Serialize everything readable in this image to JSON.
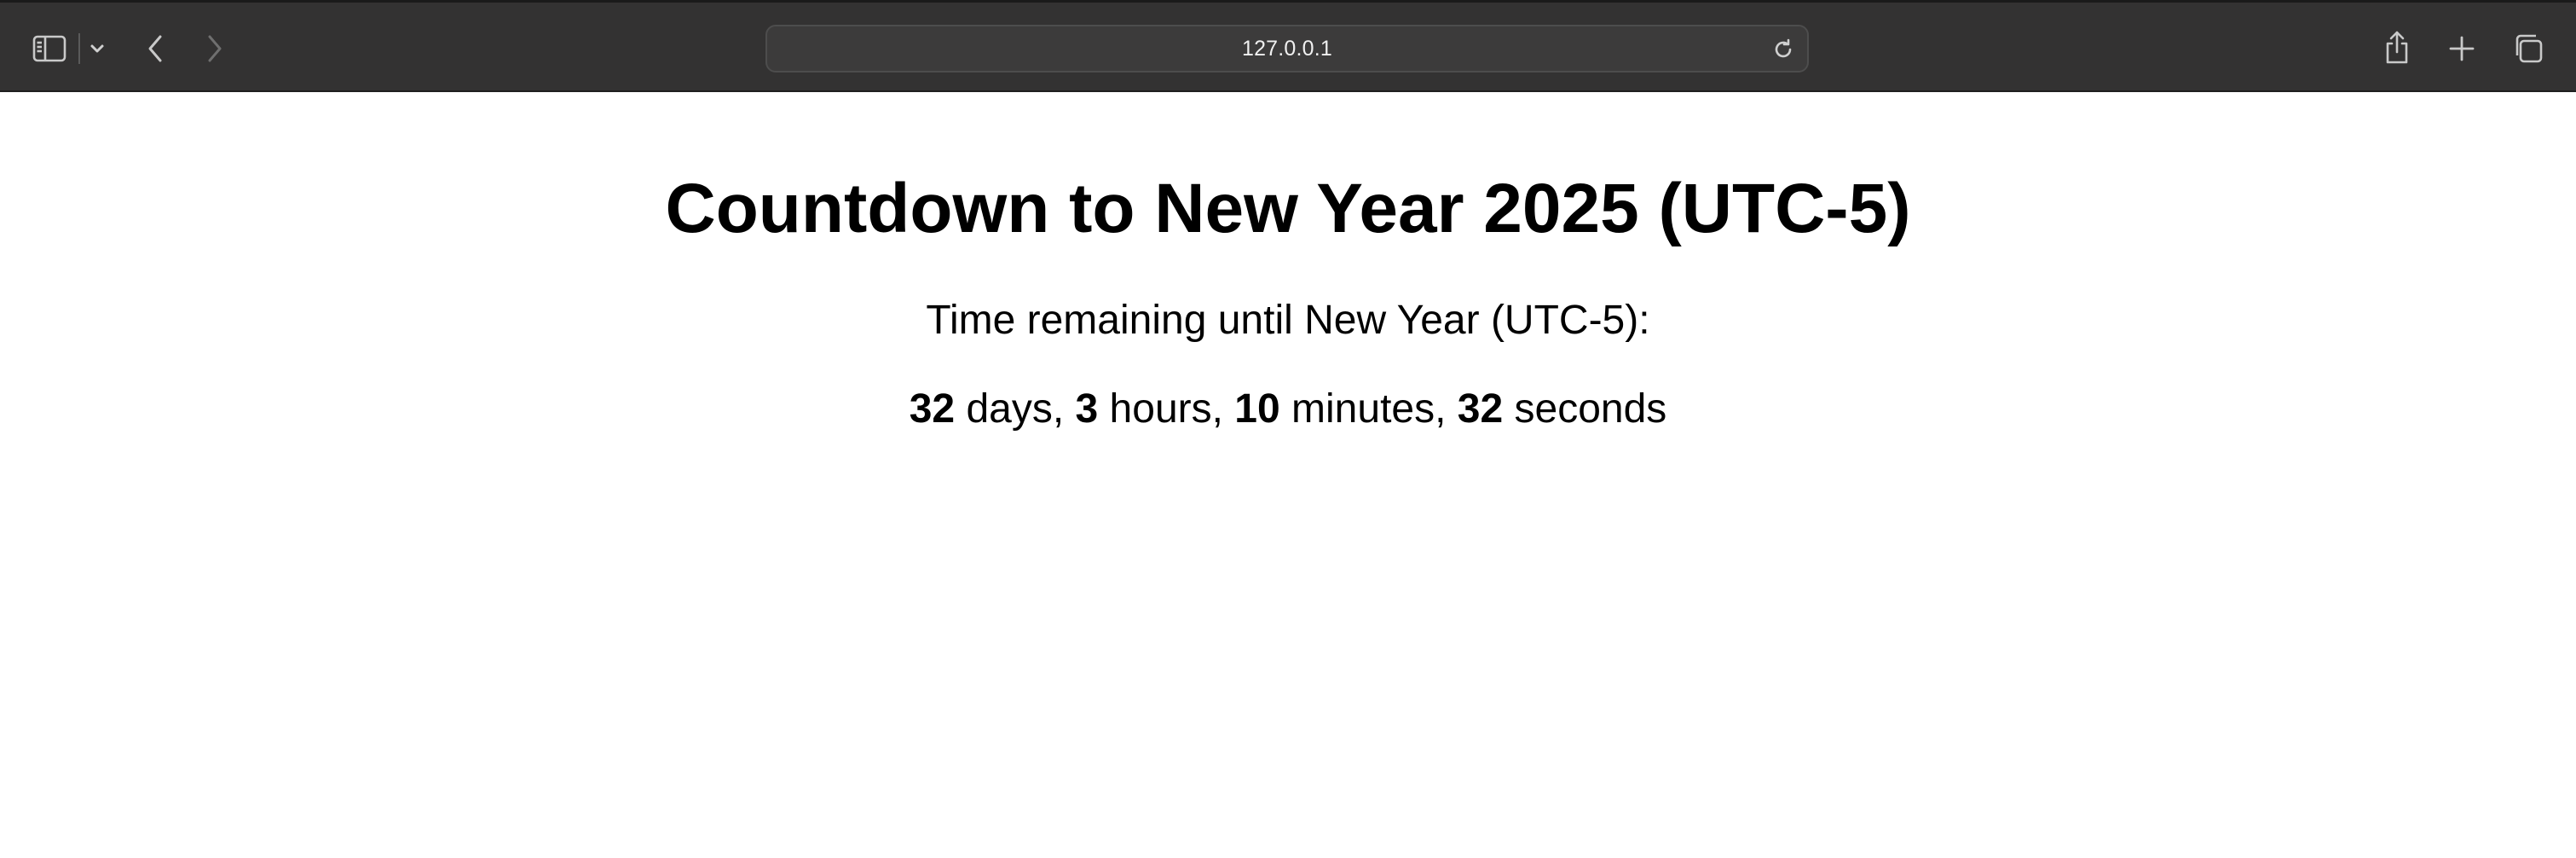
{
  "browser": {
    "url": "127.0.0.1",
    "icons": {
      "sidebar": "sidebar-icon",
      "sidebar_menu": "chevron-down-icon",
      "back": "chevron-left-icon",
      "forward": "chevron-right-icon",
      "reload": "reload-icon",
      "share": "share-icon",
      "new_tab": "plus-icon",
      "tab_overview": "tabs-overview-icon"
    },
    "toolbar_color": "#333232"
  },
  "page": {
    "title": "Countdown to New Year 2025 (UTC-5)",
    "subtitle": "Time remaining until New Year (UTC-5):",
    "countdown": {
      "days": "32",
      "days_label": " days, ",
      "hours": "3",
      "hours_label": " hours, ",
      "minutes": "10",
      "minutes_label": " minutes, ",
      "seconds": "32",
      "seconds_label": " seconds"
    }
  }
}
